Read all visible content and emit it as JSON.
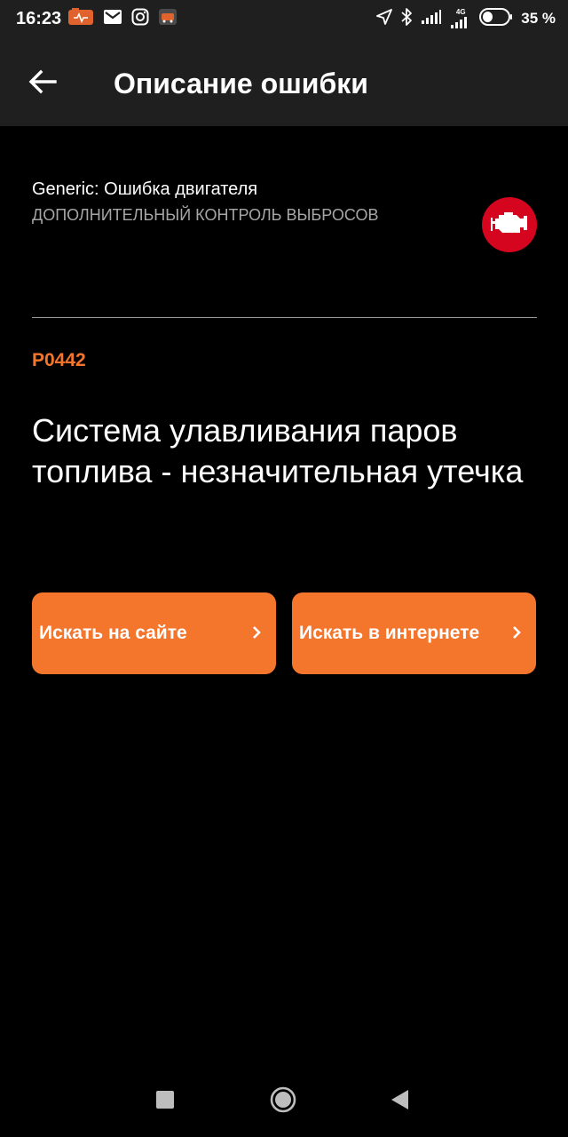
{
  "status_bar": {
    "time": "16:23",
    "battery_percent": "35 %",
    "network_type": "4G",
    "icons": [
      "pcm-scan-icon",
      "gmail-icon",
      "instagram-icon",
      "car-app-icon",
      "location-arrow-icon",
      "bluetooth-icon",
      "signal-icon",
      "signal-4g-icon",
      "battery-icon"
    ]
  },
  "app_bar": {
    "title": "Описание ошибки",
    "back_icon": "arrow-left-icon"
  },
  "error": {
    "category_title": "Generic: Ошибка двигателя",
    "category_subtitle": "ДОПОЛНИТЕЛЬНЫЙ КОНТРОЛЬ ВЫБРОСОВ",
    "badge_icon": "check-engine-icon",
    "code": "P0442",
    "description": "Система улавливания паров топлива - незначительная утечка"
  },
  "actions": {
    "search_site_label": "Искать на сайте",
    "search_web_label": "Искать в интернете"
  },
  "nav_bar": {
    "icons": [
      "recents-square-icon",
      "home-circle-icon",
      "back-triangle-icon"
    ]
  },
  "colors": {
    "accent": "#f4762d",
    "badge_red": "#d5041f",
    "bar_background": "#1f1f1f",
    "background": "#000000",
    "secondary_text": "#a6a6a6"
  }
}
